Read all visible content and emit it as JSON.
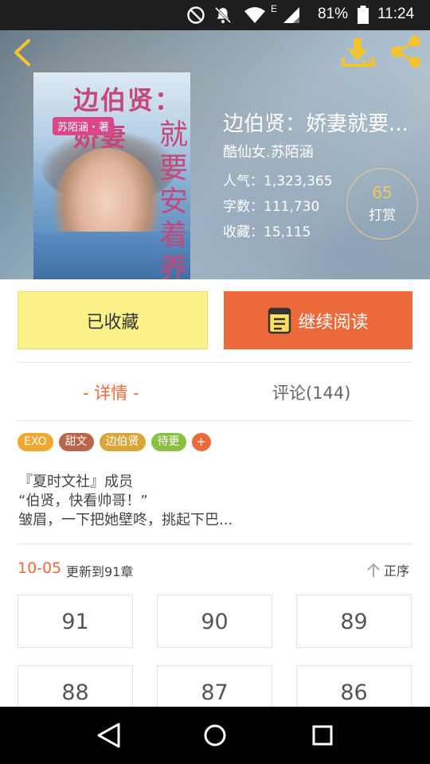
{
  "status_bar": {
    "network_type": "E",
    "battery": "81%",
    "time": "11:24",
    "icons": [
      "do-not-disturb-icon",
      "notifications-off-icon",
      "wifi-icon",
      "signal-icon",
      "battery-icon"
    ]
  },
  "header": {
    "back_icon": "chevron-left-icon",
    "download_icon": "download-icon",
    "share_icon": "share-icon",
    "cover": {
      "title": "边伯贤：娇妻",
      "author": "苏陌涵・著",
      "vertical": "就要安着养"
    },
    "book": {
      "title": "边伯贤：娇妻就要...",
      "author": "酷仙女.苏陌涵",
      "popularity": "人气：1,323,365",
      "word_count": "字数：111,730",
      "favorites": "收藏：15,115"
    },
    "reward": {
      "count": "65",
      "label": "打赏"
    }
  },
  "actions": {
    "favorite_label": "已收藏",
    "read_label": "继续阅读",
    "book_icon": "book-icon"
  },
  "tabs": {
    "detail": "- 详情 -",
    "comments": "评论(144)"
  },
  "tags": [
    {
      "label": "EXO",
      "color": "#f0a830"
    },
    {
      "label": "甜文",
      "color": "#b8654a"
    },
    {
      "label": "边伯贤",
      "color": "#d9a63a"
    },
    {
      "label": "待更",
      "color": "#8abf46"
    },
    {
      "label": "+",
      "color": "#ec6a3a"
    }
  ],
  "description": {
    "line1": "『夏时文社』成员",
    "line2": "“伯贤，快看帅哥！”",
    "line3": "皱眉，一下把她壁咚，挑起下巴..."
  },
  "update": {
    "date": "10-05",
    "text": "更新到91章",
    "order_label": "正序",
    "order_icon": "arrow-up-icon"
  },
  "chapters": [
    "91",
    "90",
    "89",
    "88",
    "87",
    "86"
  ],
  "nav": {
    "back": "back-triangle-icon",
    "home": "home-circle-icon",
    "recents": "recents-square-icon"
  },
  "colors": {
    "accent": "#ec6a3a",
    "favorite_bg": "#fbf28a",
    "reward_number": "#f0c95a"
  }
}
